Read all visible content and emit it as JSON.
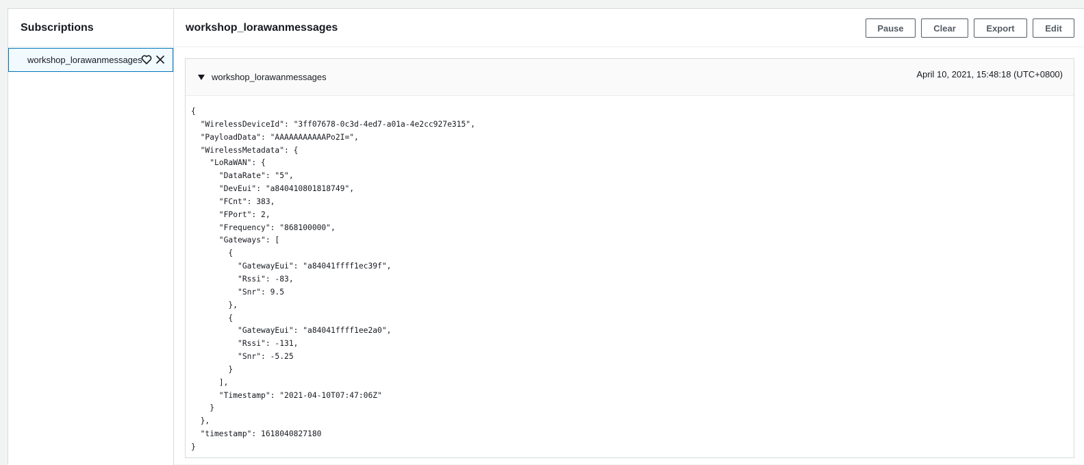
{
  "sidebar": {
    "title": "Subscriptions",
    "items": [
      {
        "label": "workshop_lorawanmessages",
        "icons": [
          "heart-outline-icon",
          "close-icon"
        ]
      }
    ]
  },
  "main": {
    "title": "workshop_lorawanmessages",
    "toolbar": {
      "pause_label": "Pause",
      "clear_label": "Clear",
      "export_label": "Export",
      "edit_label": "Edit"
    },
    "message": {
      "topic": "workshop_lorawanmessages",
      "timestamp": "April 10, 2021, 15:48:18 (UTC+0800)",
      "payload_lines": [
        "{",
        "  \"WirelessDeviceId\": \"3ff07678-0c3d-4ed7-a01a-4e2cc927e315\",",
        "  \"PayloadData\": \"AAAAAAAAAAAPo2I=\",",
        "  \"WirelessMetadata\": {",
        "    \"LoRaWAN\": {",
        "      \"DataRate\": \"5\",",
        "      \"DevEui\": \"a840410801818749\",",
        "      \"FCnt\": 383,",
        "      \"FPort\": 2,",
        "      \"Frequency\": \"868100000\",",
        "      \"Gateways\": [",
        "        {",
        "          \"GatewayEui\": \"a84041ffff1ec39f\",",
        "          \"Rssi\": -83,",
        "          \"Snr\": 9.5",
        "        },",
        "        {",
        "          \"GatewayEui\": \"a84041ffff1ee2a0\",",
        "          \"Rssi\": -131,",
        "          \"Snr\": -5.25",
        "        }",
        "      ],",
        "      \"Timestamp\": \"2021-04-10T07:47:06Z\"",
        "    }",
        "  },",
        "  \"timestamp\": 1618040827180",
        "}"
      ]
    }
  },
  "colors": {
    "selected_border": "#0073bb",
    "selected_bg": "#f1faff",
    "button_border": "#545b64",
    "text": "#16191f"
  }
}
